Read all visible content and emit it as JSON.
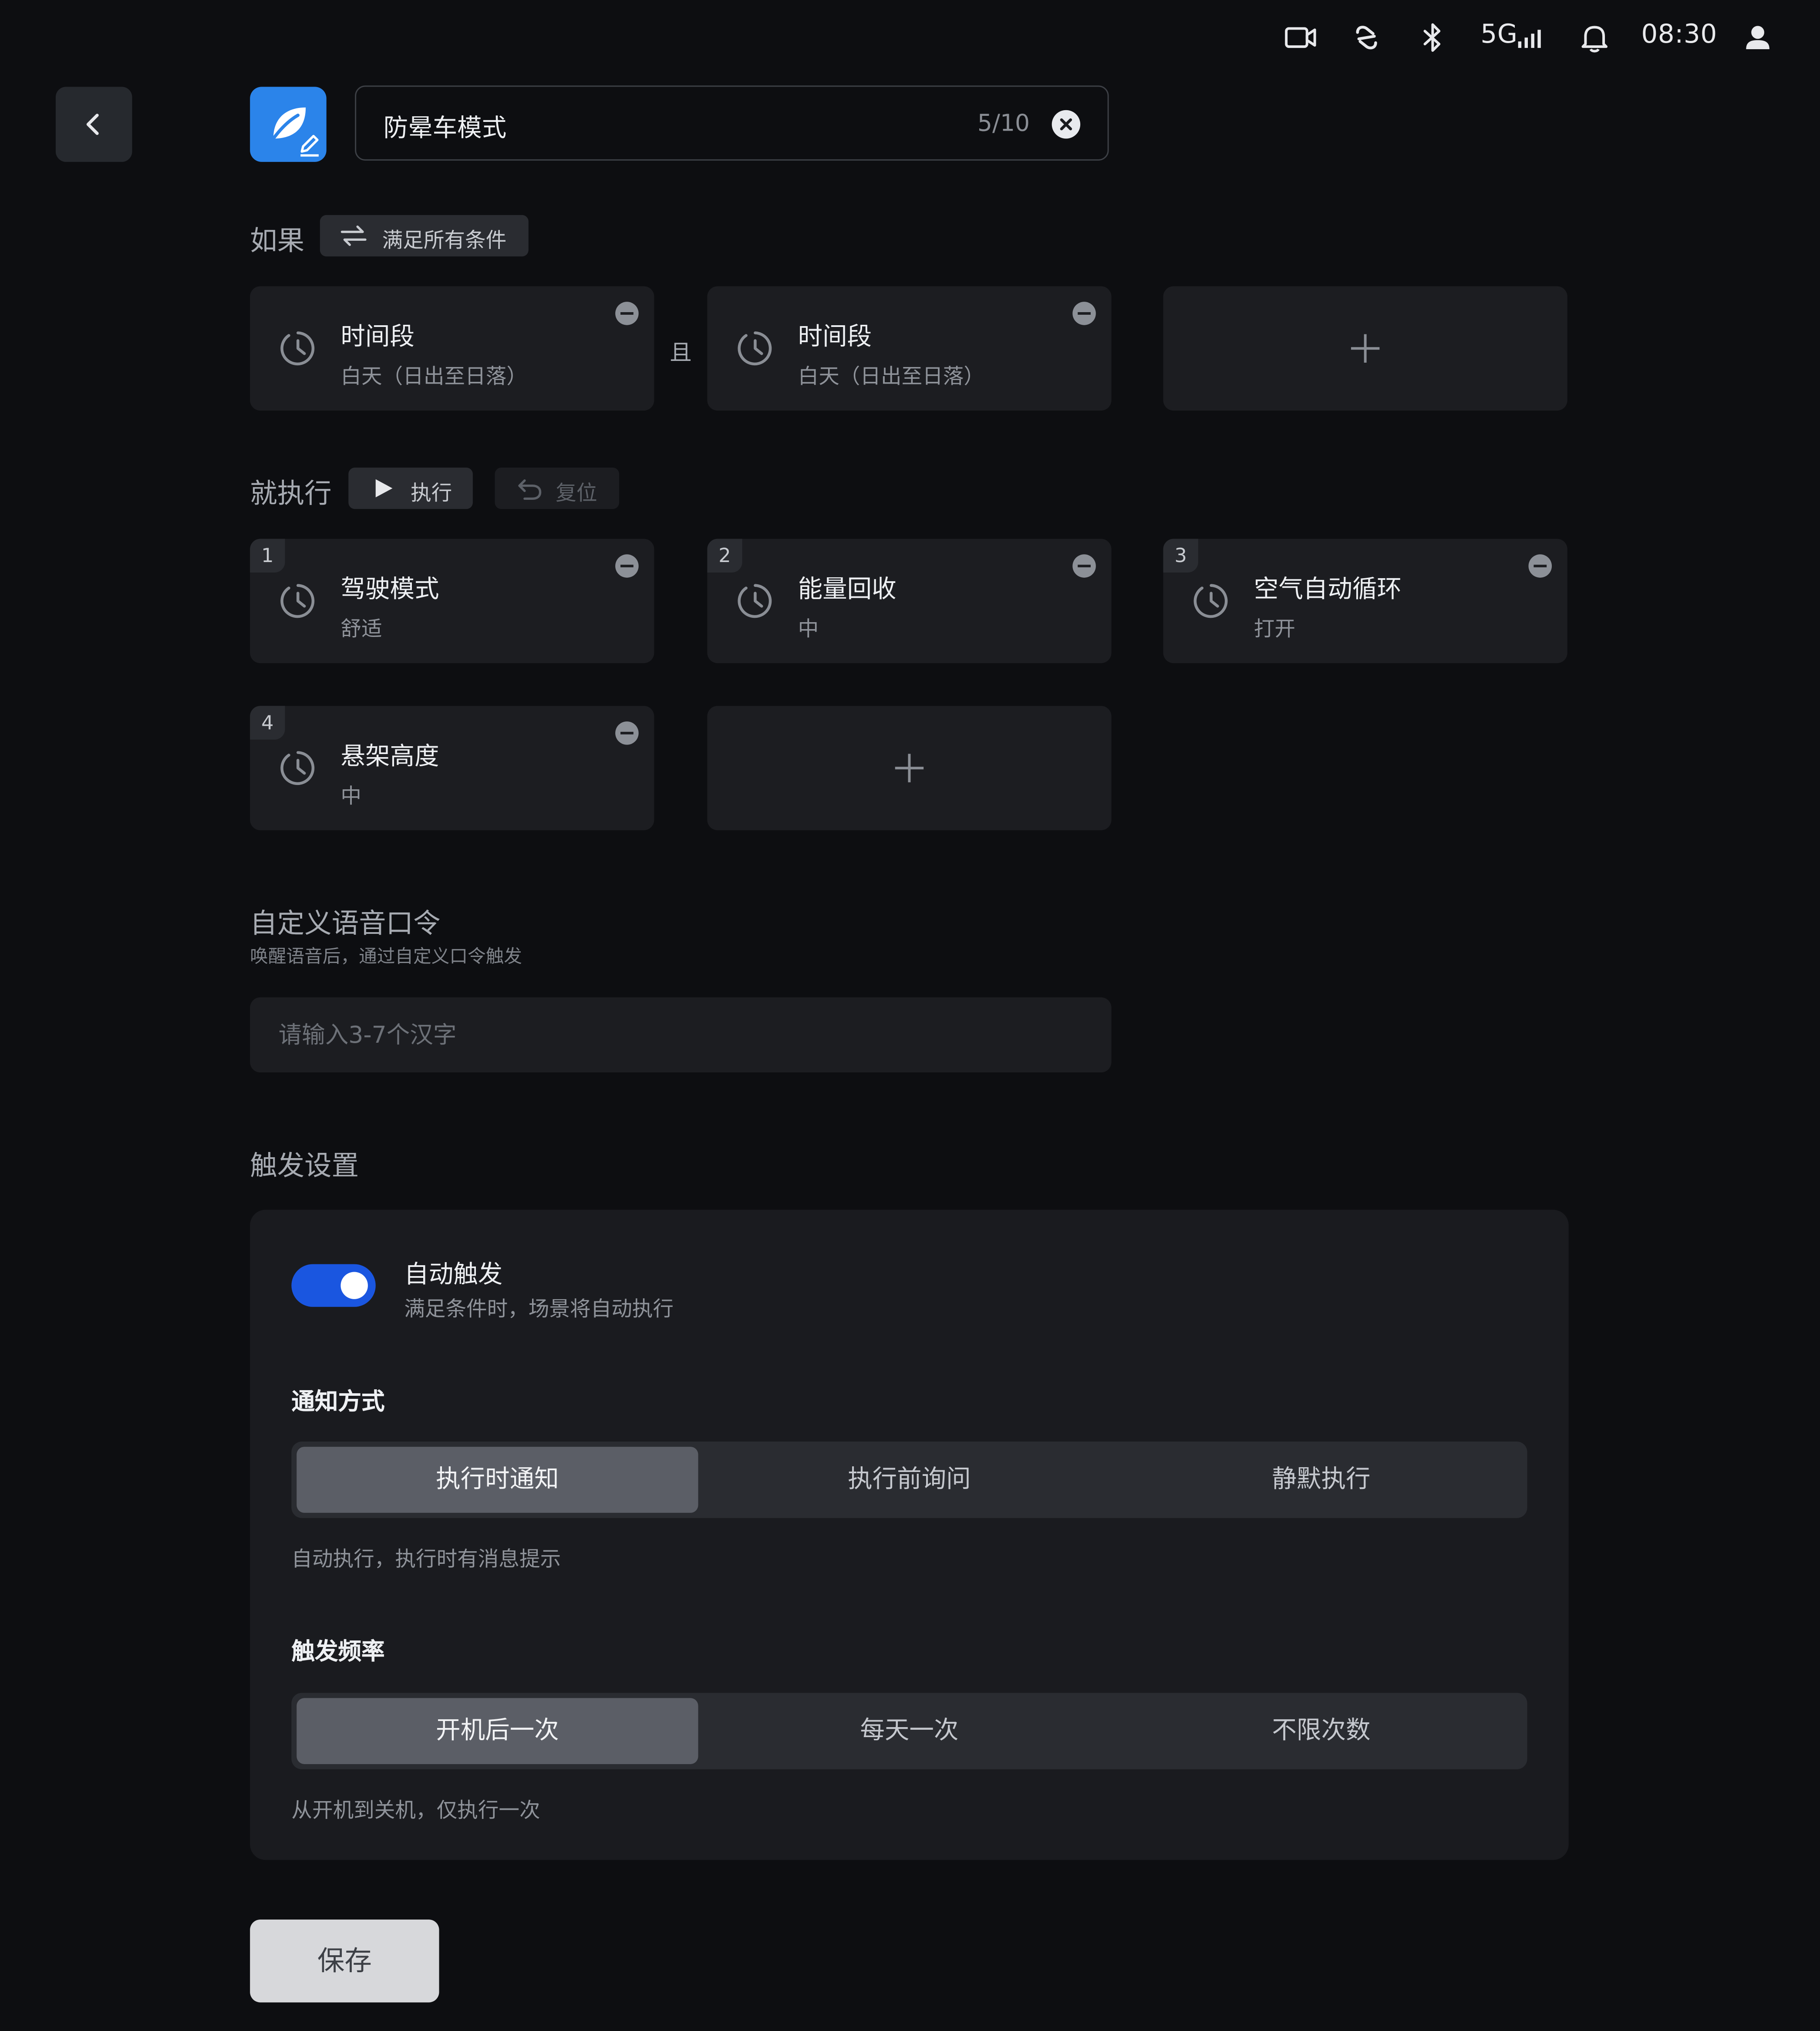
{
  "status_bar": {
    "network": "5G",
    "time": "08:30"
  },
  "header": {
    "scene_name": "防晕车模式",
    "name_counter": "5/10"
  },
  "condition": {
    "title": "如果",
    "match_mode": "满足所有条件",
    "connector": "且",
    "items": [
      {
        "title": "时间段",
        "value": "白天（日出至日落）"
      },
      {
        "title": "时间段",
        "value": "白天（日出至日落）"
      }
    ]
  },
  "action": {
    "title": "就执行",
    "run_label": "执行",
    "reset_label": "复位",
    "items": [
      {
        "index": "1",
        "title": "驾驶模式",
        "value": "舒适"
      },
      {
        "index": "2",
        "title": "能量回收",
        "value": "中"
      },
      {
        "index": "3",
        "title": "空气自动循环",
        "value": "打开"
      },
      {
        "index": "4",
        "title": "悬架高度",
        "value": "中"
      }
    ]
  },
  "voice": {
    "title": "自定义语音口令",
    "subtitle": "唤醒语音后，通过自定义口令触发",
    "placeholder": "请输入3-7个汉字"
  },
  "trigger": {
    "title": "触发设置",
    "auto_trigger_label": "自动触发",
    "auto_trigger_desc": "满足条件时，场景将自动执行",
    "auto_trigger_on": true,
    "notify": {
      "title": "通知方式",
      "options": [
        "执行时通知",
        "执行前询问",
        "静默执行"
      ],
      "selected": "执行时通知",
      "hint": "自动执行，执行时有消息提示"
    },
    "frequency": {
      "title": "触发频率",
      "options": [
        "开机后一次",
        "每天一次",
        "不限次数"
      ],
      "selected": "开机后一次",
      "hint": "从开机到关机，仅执行一次"
    }
  },
  "save_label": "保存",
  "colors": {
    "accent": "#1a56e0",
    "app_icon": "#2b84ea",
    "background": "#0d0e11",
    "card": "#1c1d21"
  }
}
